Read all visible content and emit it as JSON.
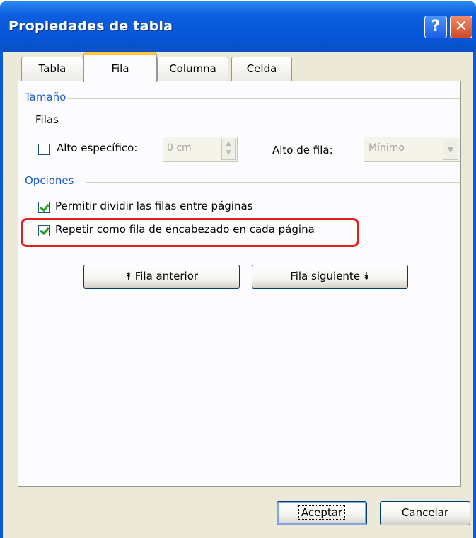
{
  "window": {
    "title": "Propiedades de tabla",
    "help_glyph": "?",
    "close_glyph": "✕"
  },
  "tabs": [
    {
      "label": "Tabla",
      "active": false
    },
    {
      "label": "Fila",
      "active": true
    },
    {
      "label": "Columna",
      "active": false
    },
    {
      "label": "Celda",
      "active": false
    }
  ],
  "size_group": {
    "title": "Tamaño",
    "rows_label": "Filas",
    "specific_height_label": "Alto específico:",
    "specific_height_checked": false,
    "height_value": "0 cm",
    "row_height_label": "Alto de fila:",
    "row_height_value": "Mínimo"
  },
  "options_group": {
    "title": "Opciones",
    "allow_split_label": "Permitir dividir las filas entre páginas",
    "allow_split_checked": true,
    "repeat_header_label": "Repetir como fila de encabezado en cada página",
    "repeat_header_checked": true
  },
  "nav": {
    "prev_label": "⯭ Fila anterior",
    "next_label": "Fila siguiente ⯯"
  },
  "footer": {
    "ok_label": "Aceptar",
    "cancel_label": "Cancelar"
  },
  "colors": {
    "title_bar": "#0656d8",
    "group_title": "#1e5aca",
    "highlight": "#e02222",
    "check": "#21a121"
  }
}
